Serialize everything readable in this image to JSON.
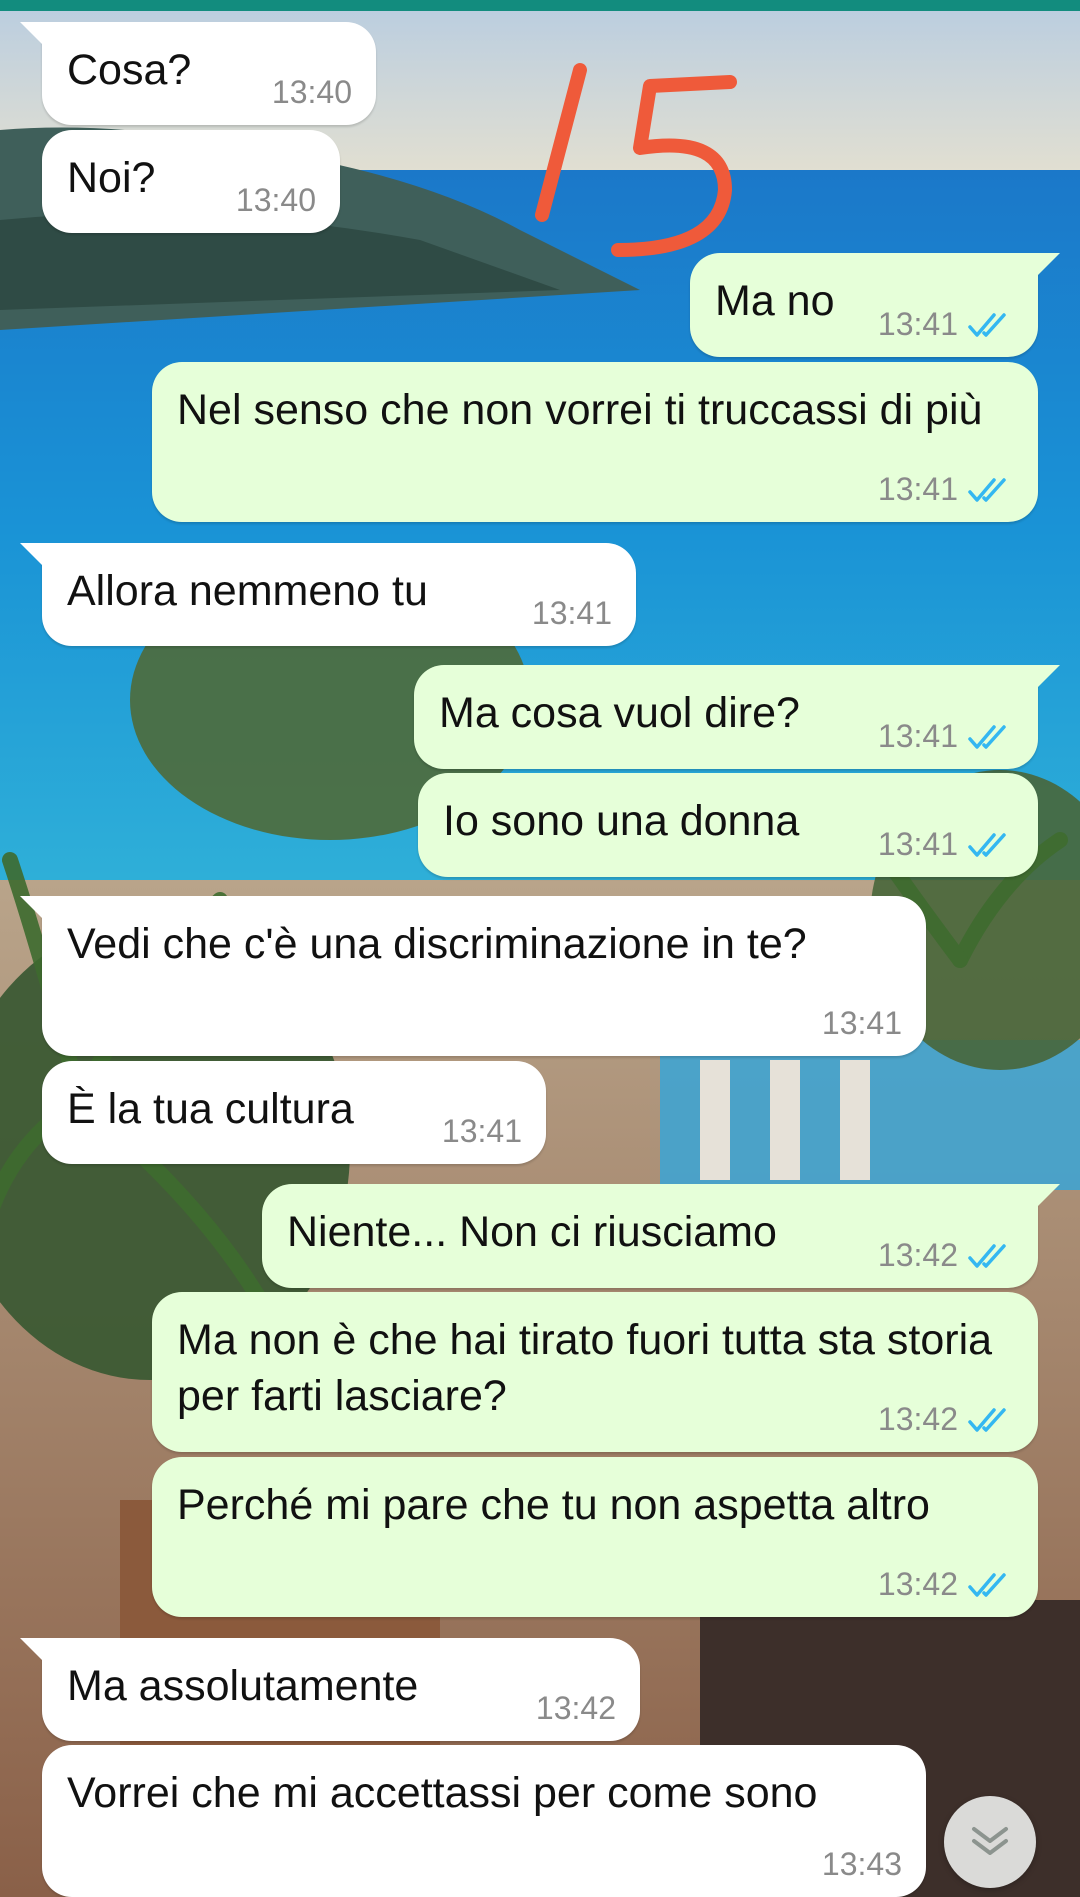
{
  "colors": {
    "header_green": "#128c7e",
    "incoming_bubble": "#ffffff",
    "outgoing_bubble": "#e6ffd9",
    "read_ticks": "#34b7f1",
    "annotation": "#ef5a3a"
  },
  "annotation": {
    "text": "15"
  },
  "messages": [
    {
      "direction": "in",
      "text": "Cosa?",
      "time": "13:40"
    },
    {
      "direction": "in",
      "text": "Noi?",
      "time": "13:40"
    },
    {
      "direction": "out",
      "text": "Ma no",
      "time": "13:41",
      "status": "read"
    },
    {
      "direction": "out",
      "text": "Nel senso che non vorrei ti truccassi di più",
      "time": "13:41",
      "status": "read"
    },
    {
      "direction": "in",
      "text": "Allora nemmeno tu",
      "time": "13:41"
    },
    {
      "direction": "out",
      "text": "Ma cosa vuol dire?",
      "time": "13:41",
      "status": "read"
    },
    {
      "direction": "out",
      "text": "Io sono una donna",
      "time": "13:41",
      "status": "read"
    },
    {
      "direction": "in",
      "text": "Vedi che c'è una discriminazione in te?",
      "time": "13:41"
    },
    {
      "direction": "in",
      "text": "È la tua cultura",
      "time": "13:41"
    },
    {
      "direction": "out",
      "text": "Niente... Non ci riusciamo",
      "time": "13:42",
      "status": "read"
    },
    {
      "direction": "out",
      "text": "Ma non è che hai tirato fuori tutta sta storia per farti lasciare?",
      "time": "13:42",
      "status": "read"
    },
    {
      "direction": "out",
      "text": "Perché mi pare che tu non aspetta altro",
      "time": "13:42",
      "status": "read"
    },
    {
      "direction": "in",
      "text": "Ma assolutamente",
      "time": "13:42"
    },
    {
      "direction": "in",
      "text": "Vorrei che mi accettassi per come sono",
      "time": "13:43"
    }
  ],
  "scroll_button": {
    "icon": "double-chevron-down-icon"
  }
}
